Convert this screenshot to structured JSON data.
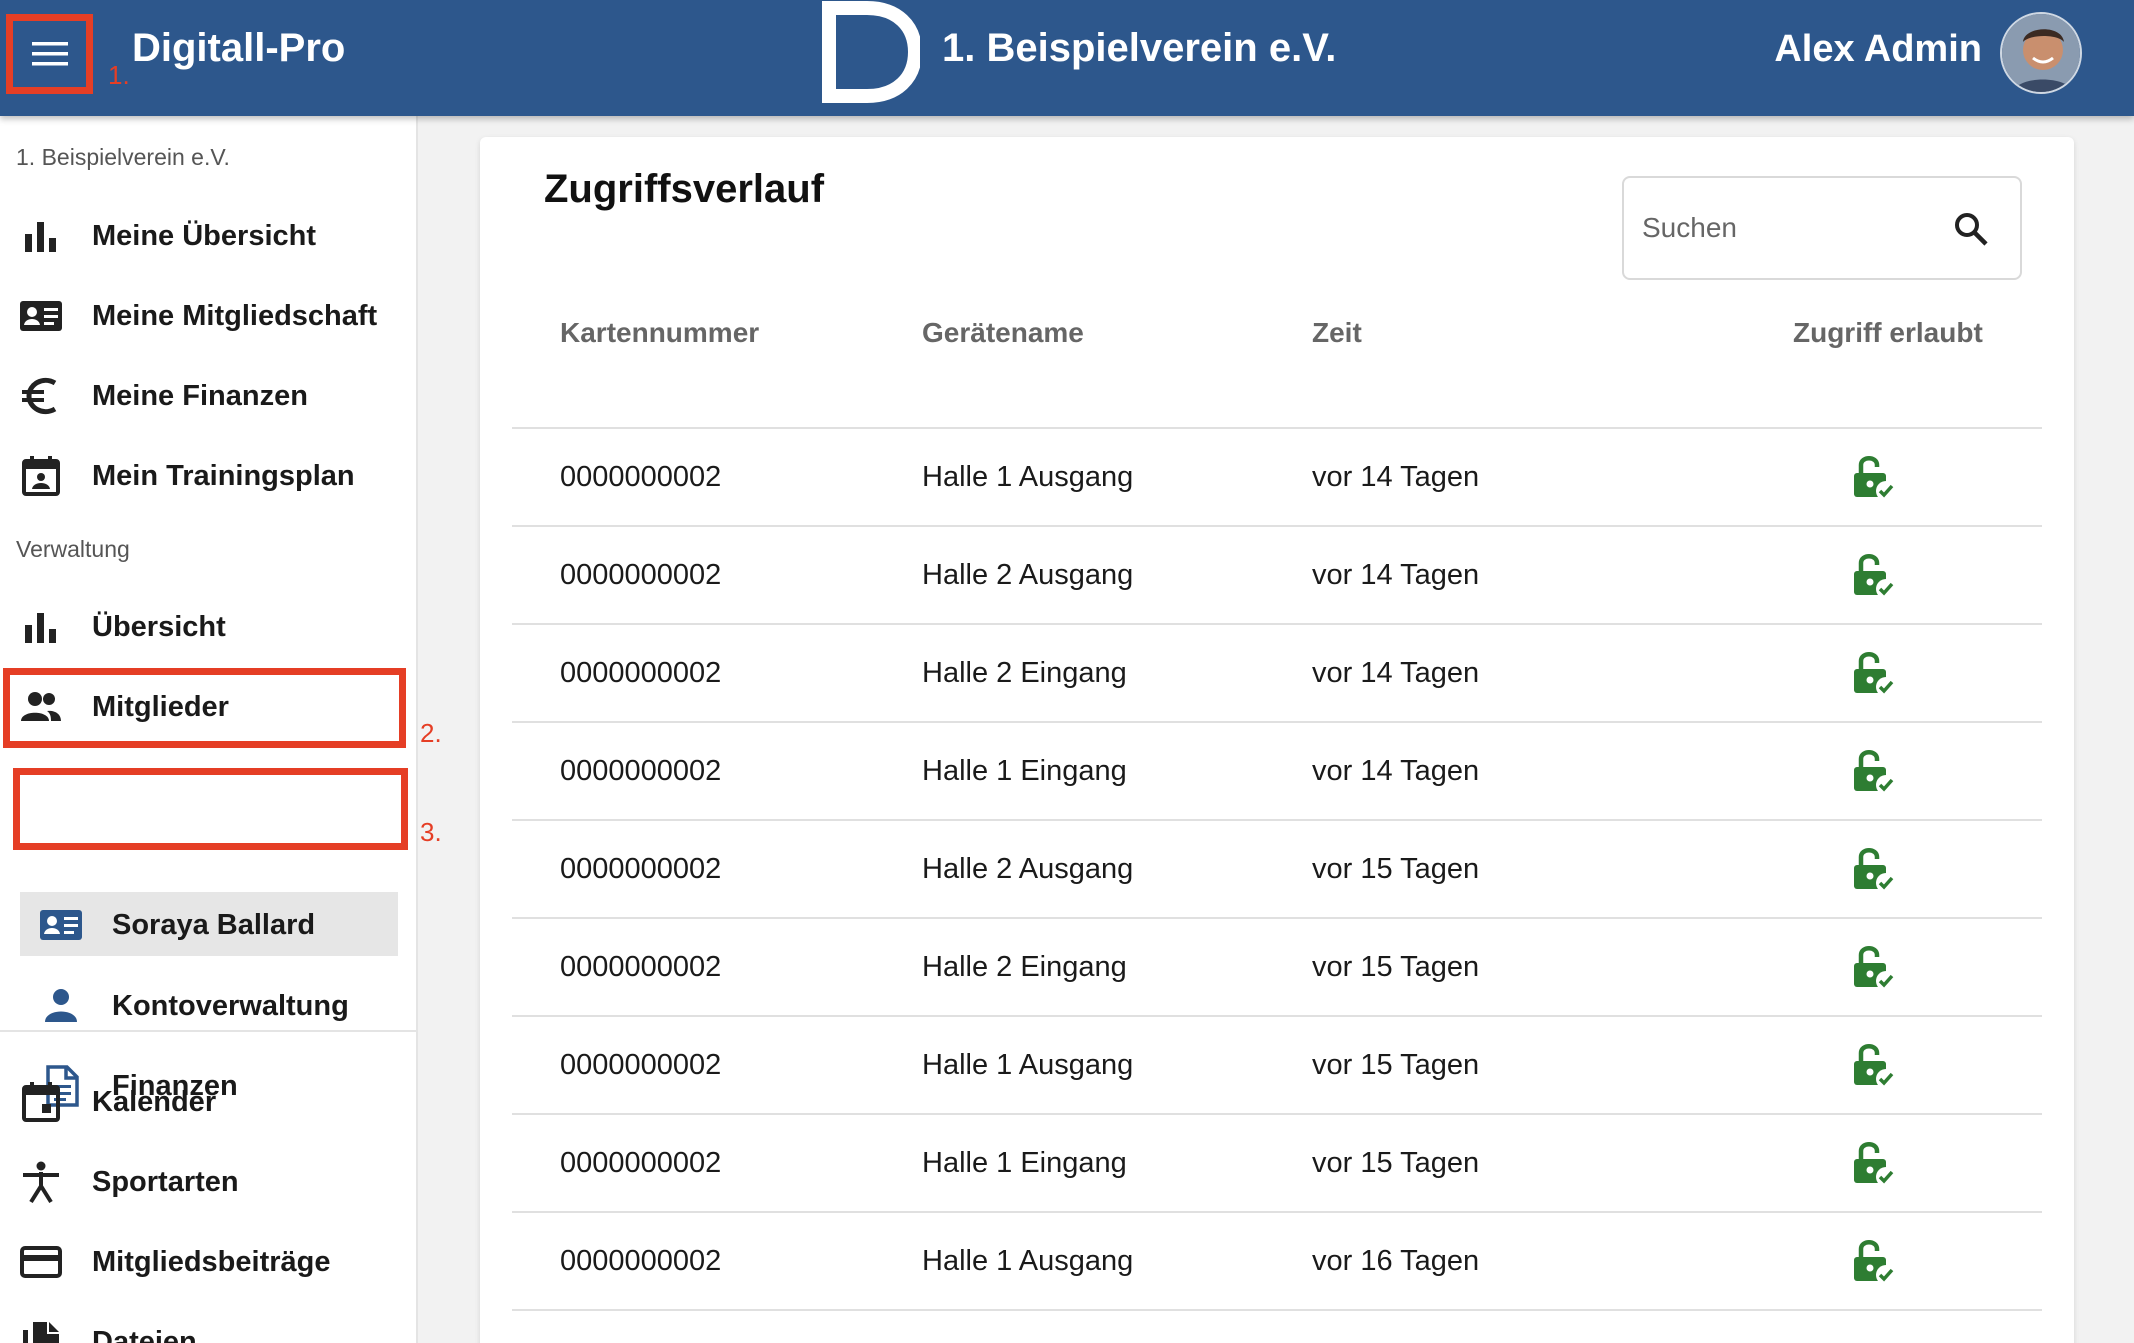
{
  "header": {
    "app_title": "Digitall-Pro",
    "club_name": "1. Beispielverein e.V.",
    "user_name": "Alex Admin",
    "brand_color": "#2d578c",
    "menu_icon": "hamburger-menu-icon"
  },
  "annotations": {
    "step1": "1.",
    "step2": "2.",
    "step3": "3.",
    "color": "#e53e25"
  },
  "sidebar": {
    "club_label": "1. Beispielverein e.V.",
    "personal_items": [
      {
        "label": "Meine Übersicht",
        "icon": "bar-chart-icon"
      },
      {
        "label": "Meine Mitgliedschaft",
        "icon": "id-card-icon"
      },
      {
        "label": "Meine Finanzen",
        "icon": "euro-icon"
      },
      {
        "label": "Mein Trainingsplan",
        "icon": "calendar-person-icon"
      }
    ],
    "admin_label": "Verwaltung",
    "admin_items": [
      {
        "label": "Übersicht",
        "icon": "bar-chart-icon"
      },
      {
        "label": "Mitglieder",
        "icon": "people-icon"
      }
    ],
    "member_sub_items": [
      {
        "label": "Soraya Ballard",
        "icon": "id-card-icon",
        "active": true
      },
      {
        "label": "Kontoverwaltung",
        "icon": "person-icon"
      },
      {
        "label": "Finanzen",
        "icon": "document-icon"
      }
    ],
    "more_items": [
      {
        "label": "Kalender",
        "icon": "calendar-icon"
      },
      {
        "label": "Sportarten",
        "icon": "sport-icon"
      },
      {
        "label": "Mitgliedsbeiträge",
        "icon": "credit-card-icon"
      },
      {
        "label": "Dateien",
        "icon": "files-icon"
      }
    ]
  },
  "main": {
    "title": "Zugriffsverlauf",
    "search": {
      "placeholder": "Suchen",
      "value": ""
    },
    "columns": [
      "Kartennummer",
      "Gerätename",
      "Zeit",
      "Zugriff erlaubt"
    ],
    "rows": [
      {
        "card": "0000000002",
        "device": "Halle 1 Ausgang",
        "time": "vor 14 Tagen",
        "allowed": true
      },
      {
        "card": "0000000002",
        "device": "Halle 2 Ausgang",
        "time": "vor 14 Tagen",
        "allowed": true
      },
      {
        "card": "0000000002",
        "device": "Halle 2 Eingang",
        "time": "vor 14 Tagen",
        "allowed": true
      },
      {
        "card": "0000000002",
        "device": "Halle 1 Eingang",
        "time": "vor 14 Tagen",
        "allowed": true
      },
      {
        "card": "0000000002",
        "device": "Halle 2 Ausgang",
        "time": "vor 15 Tagen",
        "allowed": true
      },
      {
        "card": "0000000002",
        "device": "Halle 2 Eingang",
        "time": "vor 15 Tagen",
        "allowed": true
      },
      {
        "card": "0000000002",
        "device": "Halle 1 Ausgang",
        "time": "vor 15 Tagen",
        "allowed": true
      },
      {
        "card": "0000000002",
        "device": "Halle 1 Eingang",
        "time": "vor 15 Tagen",
        "allowed": true
      },
      {
        "card": "0000000002",
        "device": "Halle 1 Ausgang",
        "time": "vor 16 Tagen",
        "allowed": true
      }
    ],
    "allowed_color": "#2e7d32"
  }
}
